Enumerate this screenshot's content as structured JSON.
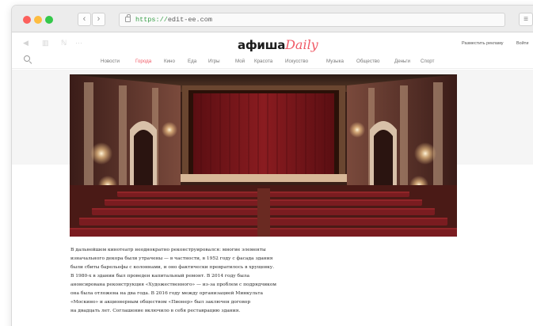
{
  "browser": {
    "back_label": "‹",
    "forward_label": "›",
    "url_scheme": "https://",
    "url_host": "edit-ee.com",
    "menu_label": "≡"
  },
  "site": {
    "logo_main": "афиша",
    "logo_accent": "Daily",
    "top_links": [
      "Разместить рекламу",
      "Войти"
    ],
    "faint_icons": [
      "◀",
      "▥",
      "ℕ",
      "···"
    ]
  },
  "nav": {
    "items": [
      "Новости",
      "Города",
      "Кино",
      "Еда",
      "Игры",
      "Мой",
      "Красота",
      "Искусство",
      "Музыка",
      "Общество",
      "Деньги",
      "Спорт"
    ],
    "active_index": 1
  },
  "photo": {
    "icon": "cinema-hall-photo"
  },
  "article": {
    "lines": [
      "В дальнейшем кинотеатр неоднократно реконструировался: многие элементы",
      "изначального декора были утрачены — в частности, в 1952 году с фасада здания",
      "были сбиты барельефы с колоннами, и оно фактически превратилось в хрущевку.",
      "В 1980-х в здании был проведен капитальный ремонт. В 2014 году была",
      "анонсирована реконструкция «Художественного» — из-за проблем с подрядчиком",
      "она была отложена на два года. В 2016 году между организацией Минкульта",
      "«Москино» и акционерным обществом «Пионер» был заключен договор",
      "на двадцать лет. Соглашение включило в себя реставрацию здания."
    ]
  },
  "colors": {
    "accent": "#f05a66",
    "curtain": "#8a1c20",
    "seats": "#6a1418"
  }
}
